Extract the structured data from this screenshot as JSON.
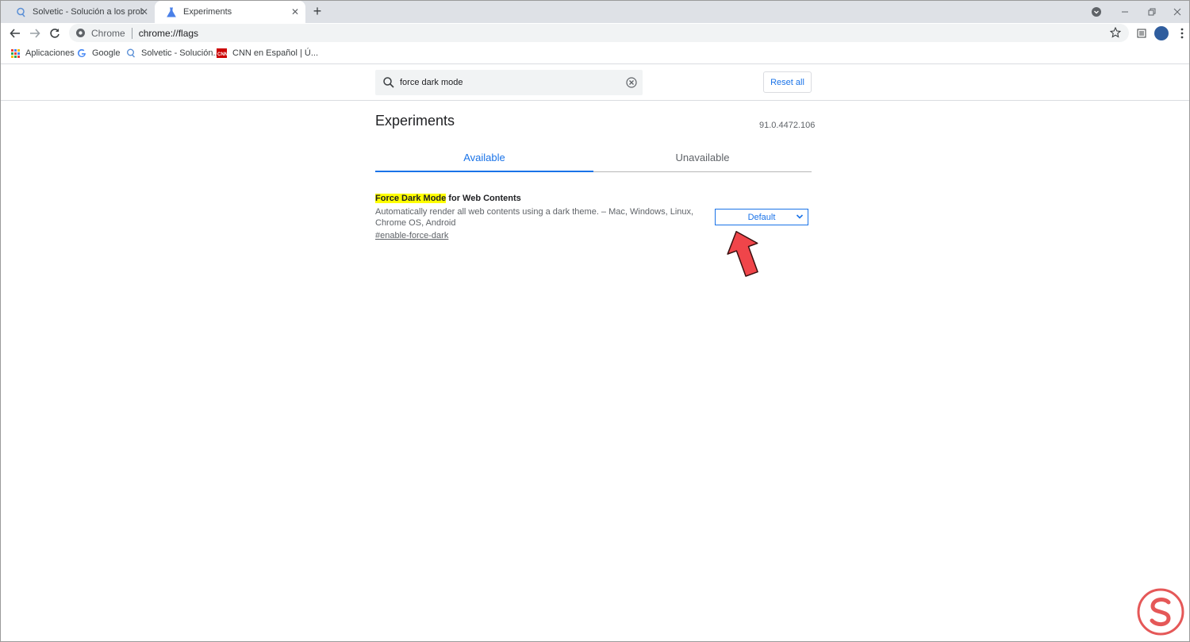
{
  "browser": {
    "tabs": [
      {
        "title": "Solvetic - Solución a los problemas",
        "close": "✕"
      },
      {
        "title": "Experiments",
        "close": "✕"
      }
    ],
    "new_tab": "+",
    "omnibox": {
      "site": "Chrome",
      "url": "chrome://flags"
    },
    "bookmarks": [
      "Aplicaciones",
      "Google",
      "Solvetic - Solución...",
      "CNN en Español | Ú..."
    ]
  },
  "flags": {
    "search": {
      "value": "force dark mode"
    },
    "reset_label": "Reset all",
    "title": "Experiments",
    "version": "91.0.4472.106",
    "tabs": [
      "Available",
      "Unavailable"
    ],
    "experiment": {
      "name_highlight": "Force Dark Mode",
      "name_rest": " for Web Contents",
      "description": "Automatically render all web contents using a dark theme. – Mac, Windows, Linux, Chrome OS, Android",
      "link": "#enable-force-dark",
      "selected_option": "Default"
    }
  },
  "colors": {
    "accent": "#1a73e8",
    "highlight": "#ffff00",
    "annotation_arrow": "#f0454a",
    "watermark": "#e03b3b"
  },
  "icons": [
    "solvetic-favicon",
    "flask-icon",
    "back-icon",
    "forward-icon",
    "reload-icon",
    "chrome-icon",
    "star-icon",
    "reading-list-icon",
    "menu-icon",
    "apps-icon",
    "google-icon",
    "cnn-icon",
    "search-icon",
    "clear-icon",
    "chevron-down-icon",
    "red-arrow-icon",
    "solvetic-logo"
  ]
}
